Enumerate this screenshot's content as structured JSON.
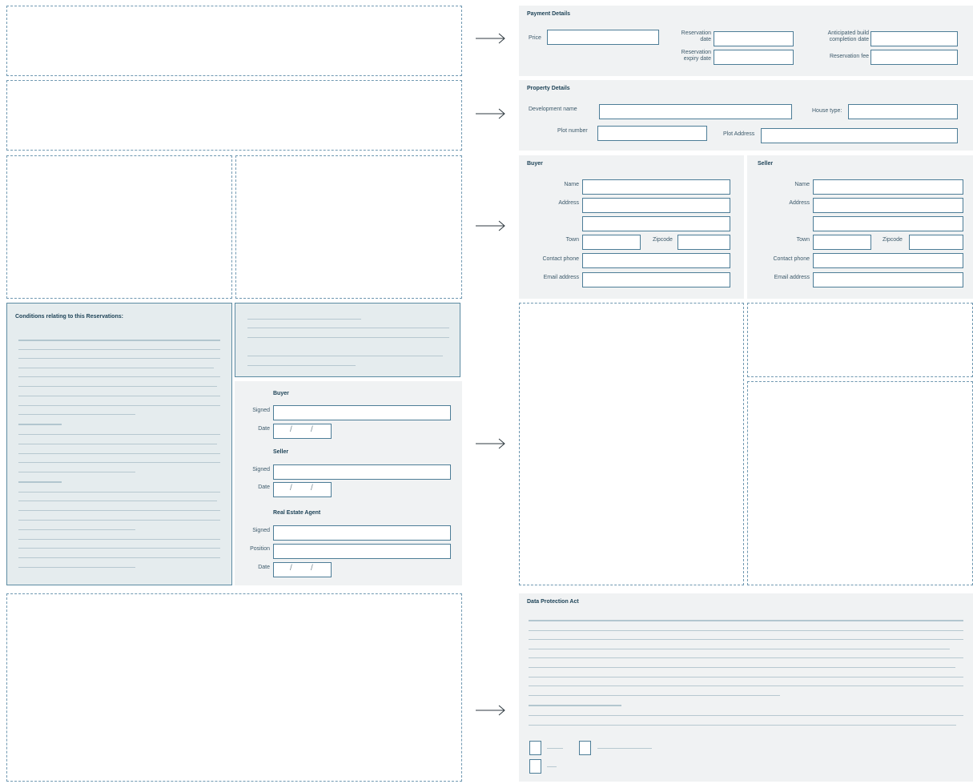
{
  "payment": {
    "title": "Payment Details",
    "price": "Price",
    "reservation_date_1": "Reservation",
    "reservation_date_2": "date",
    "completion_1": "Anticipated build",
    "completion_2": "completion date",
    "expiry_1": "Reservation",
    "expiry_2": "expiry date",
    "fee": "Reservation fee"
  },
  "property": {
    "title": "Property Details",
    "development_name": "Development name",
    "house_type": "House type:",
    "plot_number": "Plot number",
    "plot_address": "Plot Address"
  },
  "buyer": {
    "title": "Buyer",
    "name": "Name",
    "address": "Address",
    "town": "Town",
    "zipcode": "Zipcode",
    "phone": "Contact  phone",
    "email": "Email address"
  },
  "seller": {
    "title": "Seller",
    "name": "Name",
    "address": "Address",
    "town": "Town",
    "zipcode": "Zipcode",
    "phone": "Contact  phone",
    "email": "Email address"
  },
  "conditions": {
    "title": "Conditions relating to this Reservations:"
  },
  "signatures": {
    "buyer_title": "Buyer",
    "seller_title": "Seller",
    "agent_title": "Real Estate Agent",
    "signed": "Signed",
    "date": "Date",
    "position": "Position",
    "slash": "/"
  },
  "data_protection": {
    "title": "Data Protection Act"
  },
  "colors": {
    "accent": "#4d7d97",
    "panel": "#f0f2f3",
    "dash": "#6f98b1"
  }
}
